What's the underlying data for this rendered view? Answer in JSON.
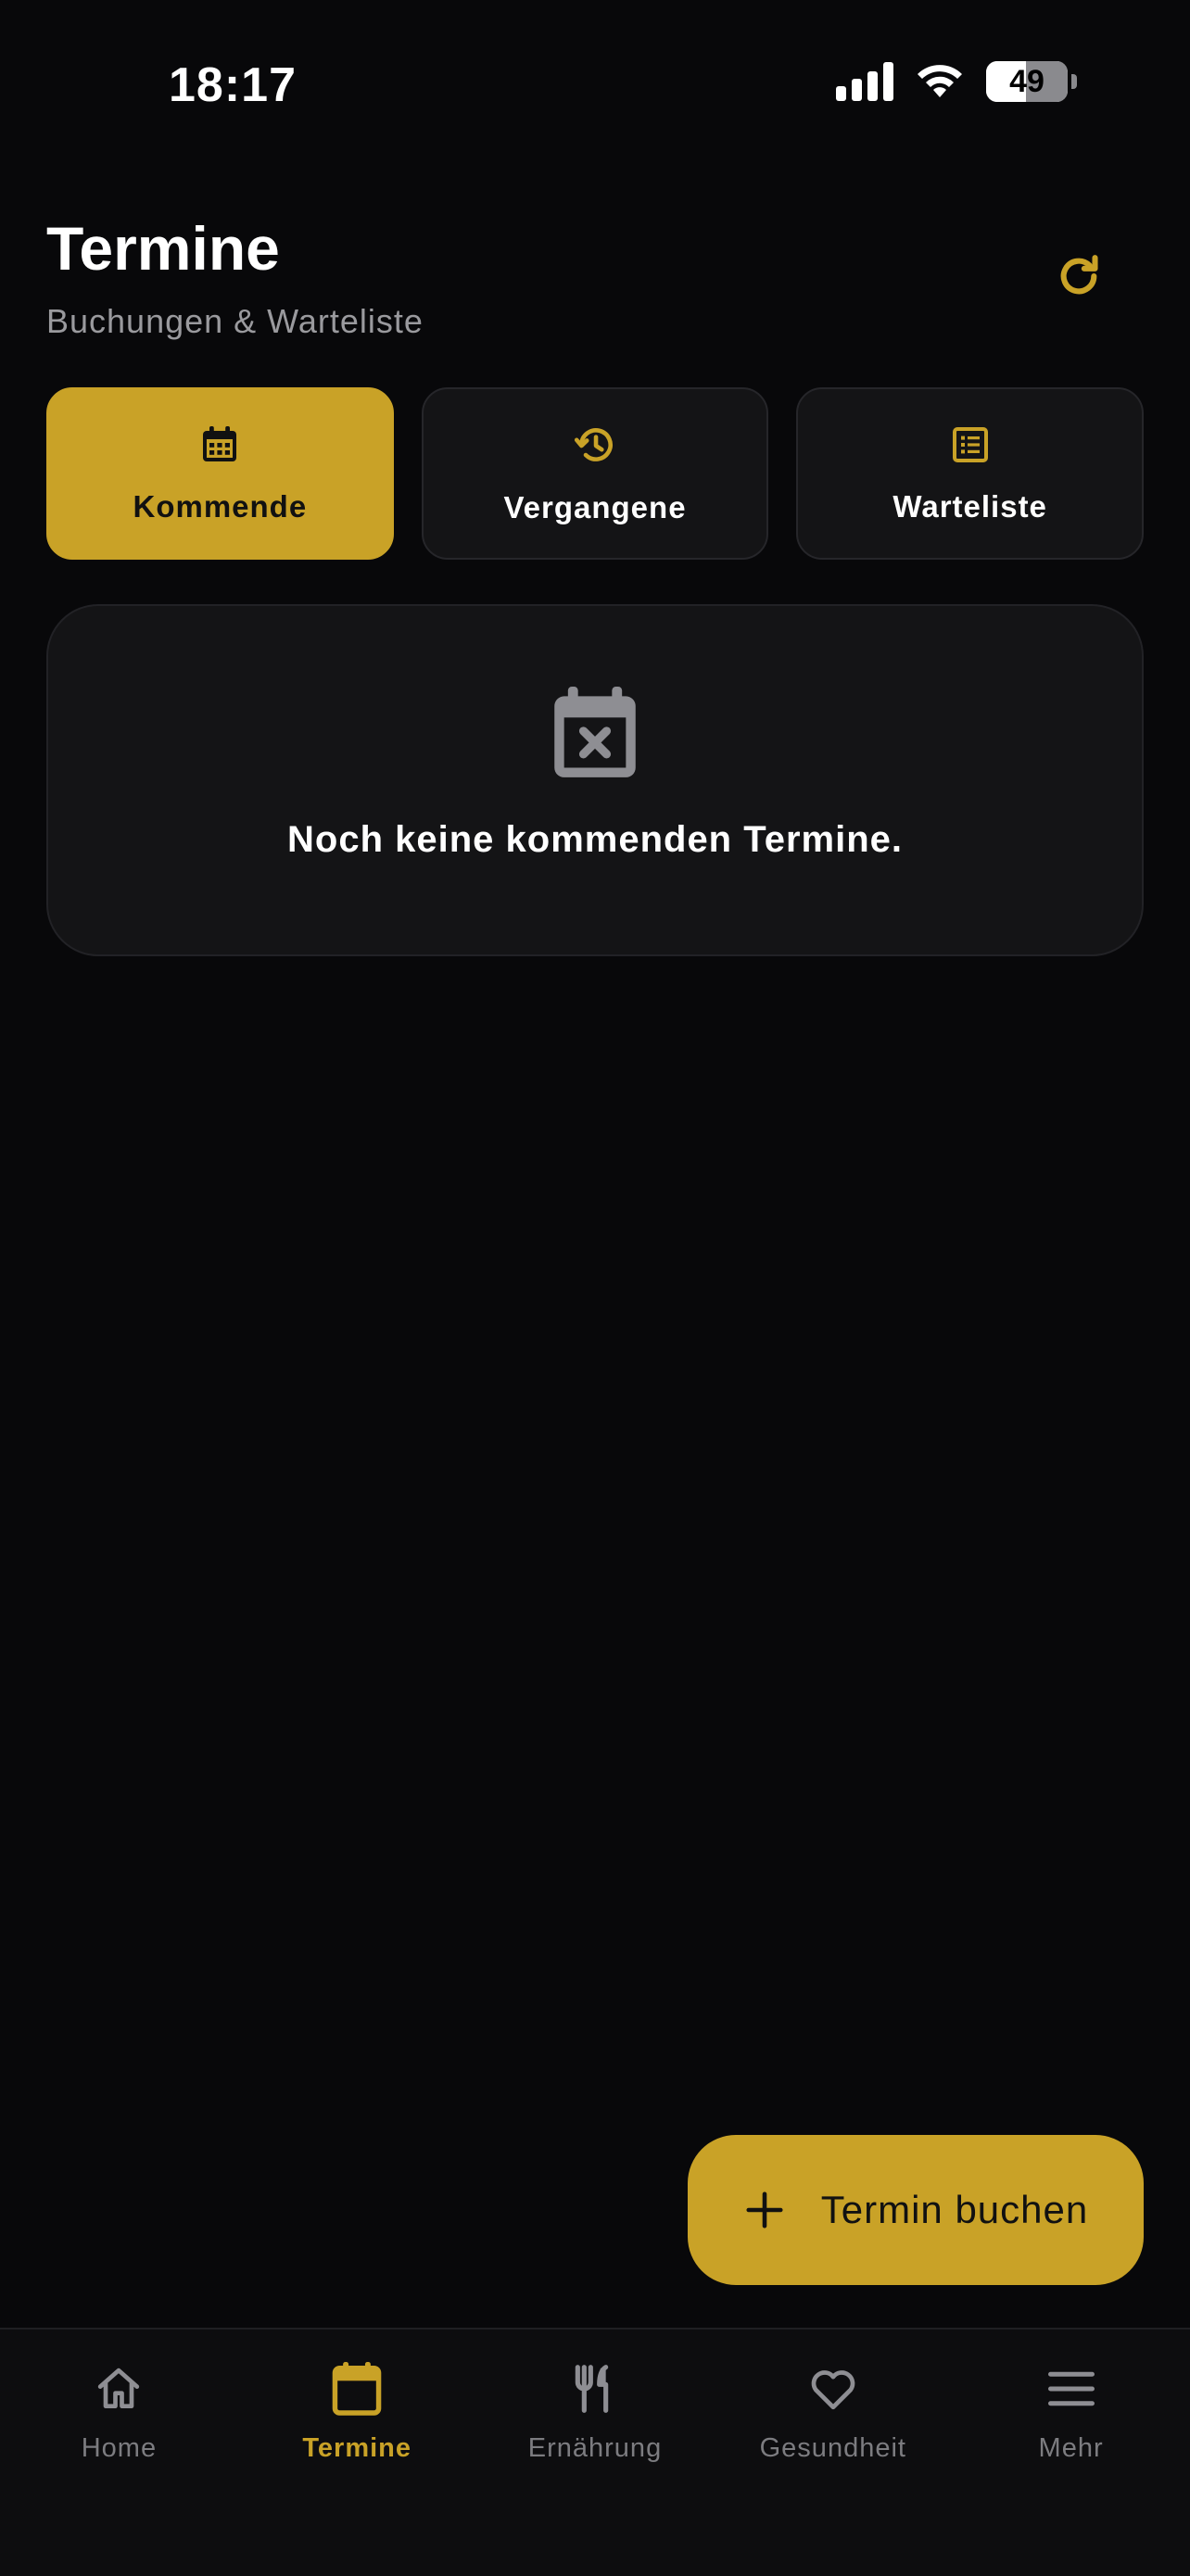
{
  "status_bar": {
    "time": "18:17",
    "battery": "49"
  },
  "header": {
    "title": "Termine",
    "subtitle": "Buchungen & Warteliste"
  },
  "tabs": [
    {
      "label": "Kommende",
      "icon": "calendar-icon",
      "active": true
    },
    {
      "label": "Vergangene",
      "icon": "history-icon",
      "active": false
    },
    {
      "label": "Warteliste",
      "icon": "list-icon",
      "active": false
    }
  ],
  "empty_state": {
    "icon": "calendar-x-icon",
    "message": "Noch keine kommenden Termine."
  },
  "fab": {
    "label": "Termin buchen",
    "icon": "plus-icon"
  },
  "bottom_nav": [
    {
      "label": "Home",
      "icon": "home-icon",
      "active": false
    },
    {
      "label": "Termine",
      "icon": "calendar-icon",
      "active": true
    },
    {
      "label": "Ernährung",
      "icon": "fork-knife-icon",
      "active": false
    },
    {
      "label": "Gesundheit",
      "icon": "heart-icon",
      "active": false
    },
    {
      "label": "Mehr",
      "icon": "menu-icon",
      "active": false
    }
  ],
  "colors": {
    "accent": "#c9a227",
    "background": "#08080a",
    "card": "#141416",
    "muted": "#7c7c80"
  }
}
